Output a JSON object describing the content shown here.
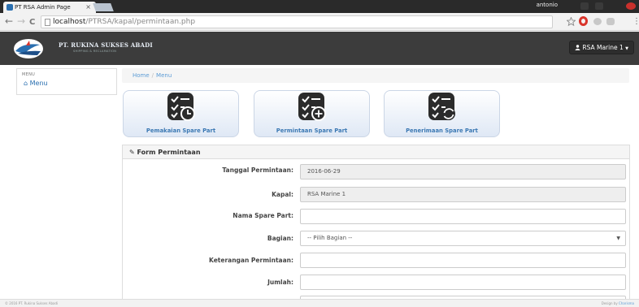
{
  "browser": {
    "tab_title": "PT RSA Admin Page",
    "tab_close": "×",
    "user": "antonio",
    "url_host": "localhost",
    "url_path": "/PTRSA/kapal/permintaan.php",
    "back": "←",
    "forward": "→",
    "reload": "C"
  },
  "header": {
    "brand": "PT. RUKINA SUKSES ABADI",
    "brand_sub": "SHIPPING & RECLAMATION",
    "user_menu": "RSA Marine 1"
  },
  "sidebar": {
    "heading": "MENU",
    "items": [
      {
        "label": "Menu"
      }
    ]
  },
  "breadcrumb": {
    "home": "Home",
    "sep": "/",
    "current": "Menu"
  },
  "tiles": [
    {
      "label": "Pemakaian Spare Part"
    },
    {
      "label": "Permintaan Spare Part"
    },
    {
      "label": "Penerimaan Spare Part"
    }
  ],
  "form": {
    "title": "Form Permintaan",
    "fields": [
      {
        "label": "Tanggal Permintaan:",
        "value": "2016-06-29"
      },
      {
        "label": "Kapal:",
        "value": "RSA Marine 1"
      },
      {
        "label": "Nama Spare Part:",
        "value": ""
      },
      {
        "label": "Bagian:",
        "value": "-- Pilih Bagian --"
      },
      {
        "label": "Keterangan Permintaan:",
        "value": ""
      },
      {
        "label": "Jumlah:",
        "value": ""
      }
    ]
  },
  "footer": {
    "copyright": "© 2016 PT. Rukina Sukses Abadi",
    "credit_prefix": "Design by",
    "credit_name": "Charisma"
  },
  "colors": {
    "header": "#3c3c3c",
    "accent": "#3b78b3",
    "link": "#5b9bd5"
  }
}
